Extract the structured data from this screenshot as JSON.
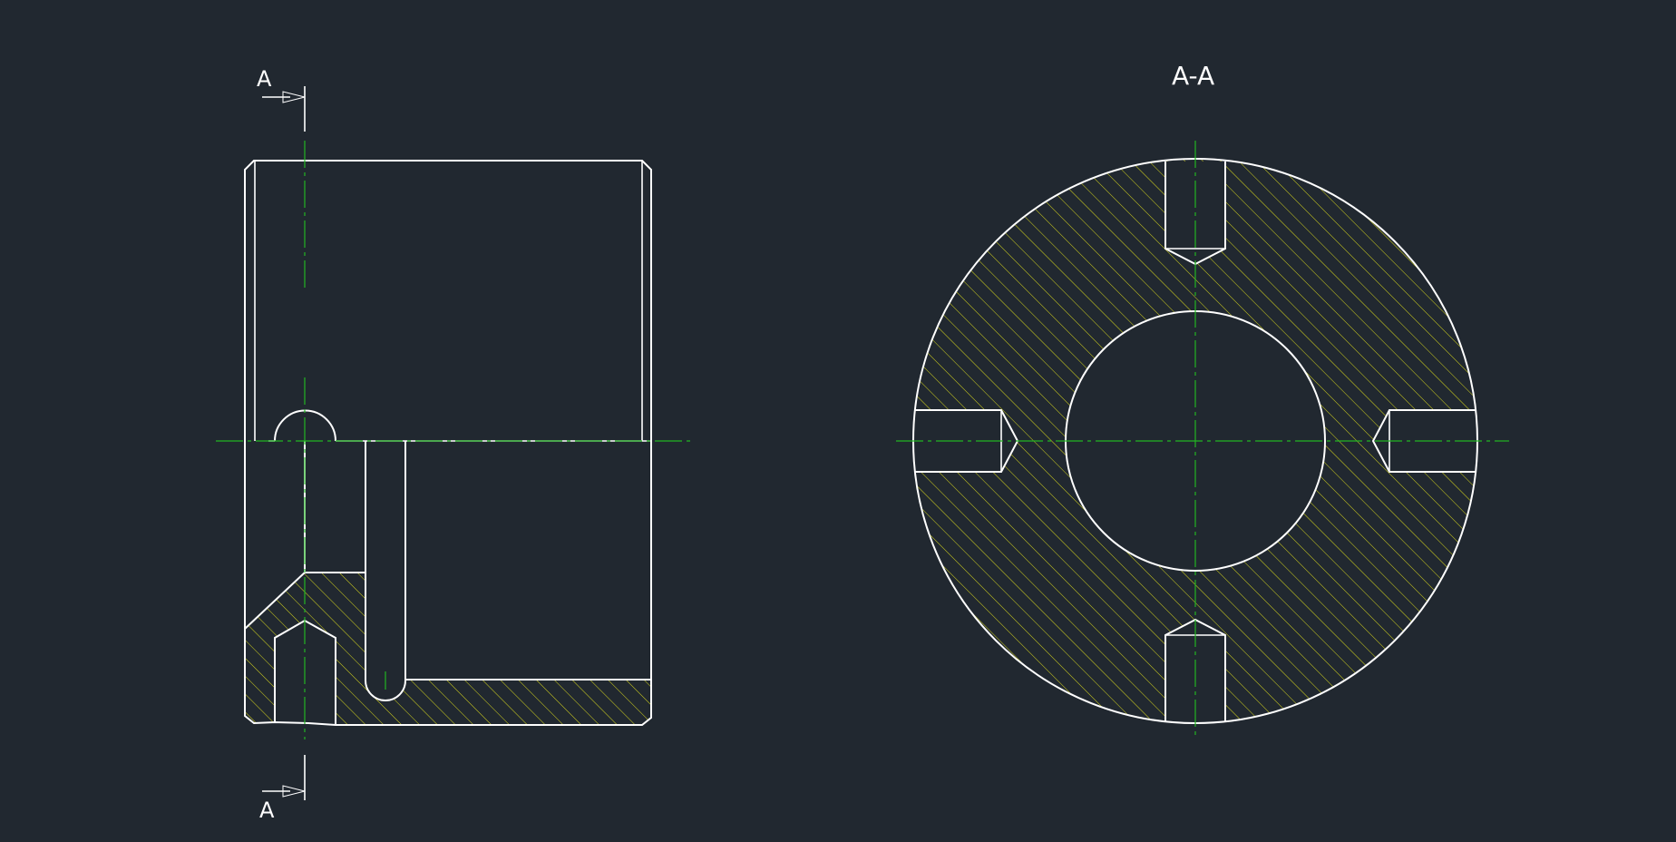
{
  "labels": {
    "cut_top": "A",
    "cut_bottom": "A",
    "section_title": "A-A"
  },
  "colors": {
    "background": "#212830",
    "outline": "#ffffff",
    "centerline": "#22b422",
    "hatch": "#d6d61e"
  }
}
